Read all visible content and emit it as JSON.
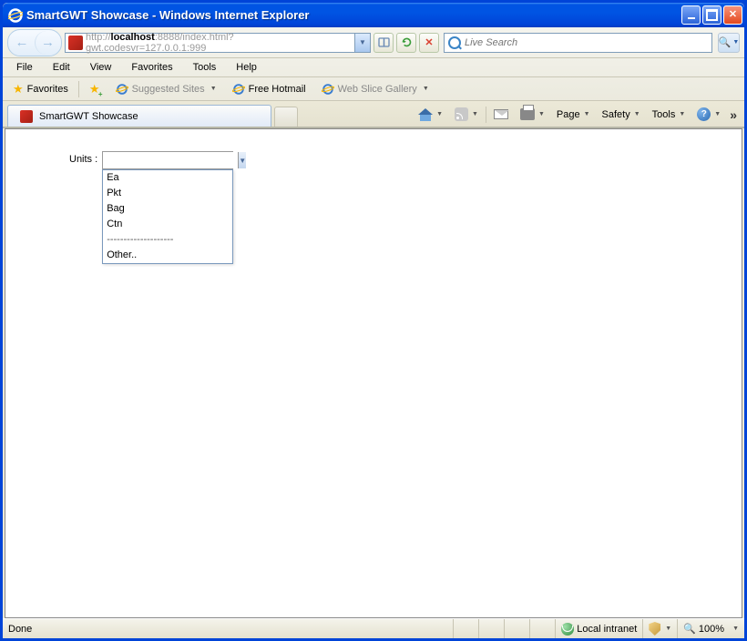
{
  "window": {
    "title": "SmartGWT Showcase - Windows Internet Explorer"
  },
  "address": {
    "url_grey1": "http://",
    "url_host": "localhost",
    "url_rest": ":8888/index.html?gwt.codesvr=127.0.0.1:999"
  },
  "search": {
    "placeholder": "Live Search"
  },
  "menus": {
    "file": "File",
    "edit": "Edit",
    "view": "View",
    "favorites": "Favorites",
    "tools": "Tools",
    "help": "Help"
  },
  "favbar": {
    "favorites_label": "Favorites",
    "suggested": "Suggested Sites",
    "hotmail": "Free Hotmail",
    "webslice": "Web Slice Gallery"
  },
  "tab": {
    "title": "SmartGWT Showcase"
  },
  "cmd": {
    "page": "Page",
    "safety": "Safety",
    "tools": "Tools"
  },
  "form": {
    "label": "Units :",
    "value": "",
    "options": [
      "Ea",
      "Pkt",
      "Bag",
      "Ctn",
      "--------------------",
      "Other.."
    ]
  },
  "status": {
    "left": "Done",
    "zone": "Local intranet",
    "zoom": "100%"
  }
}
